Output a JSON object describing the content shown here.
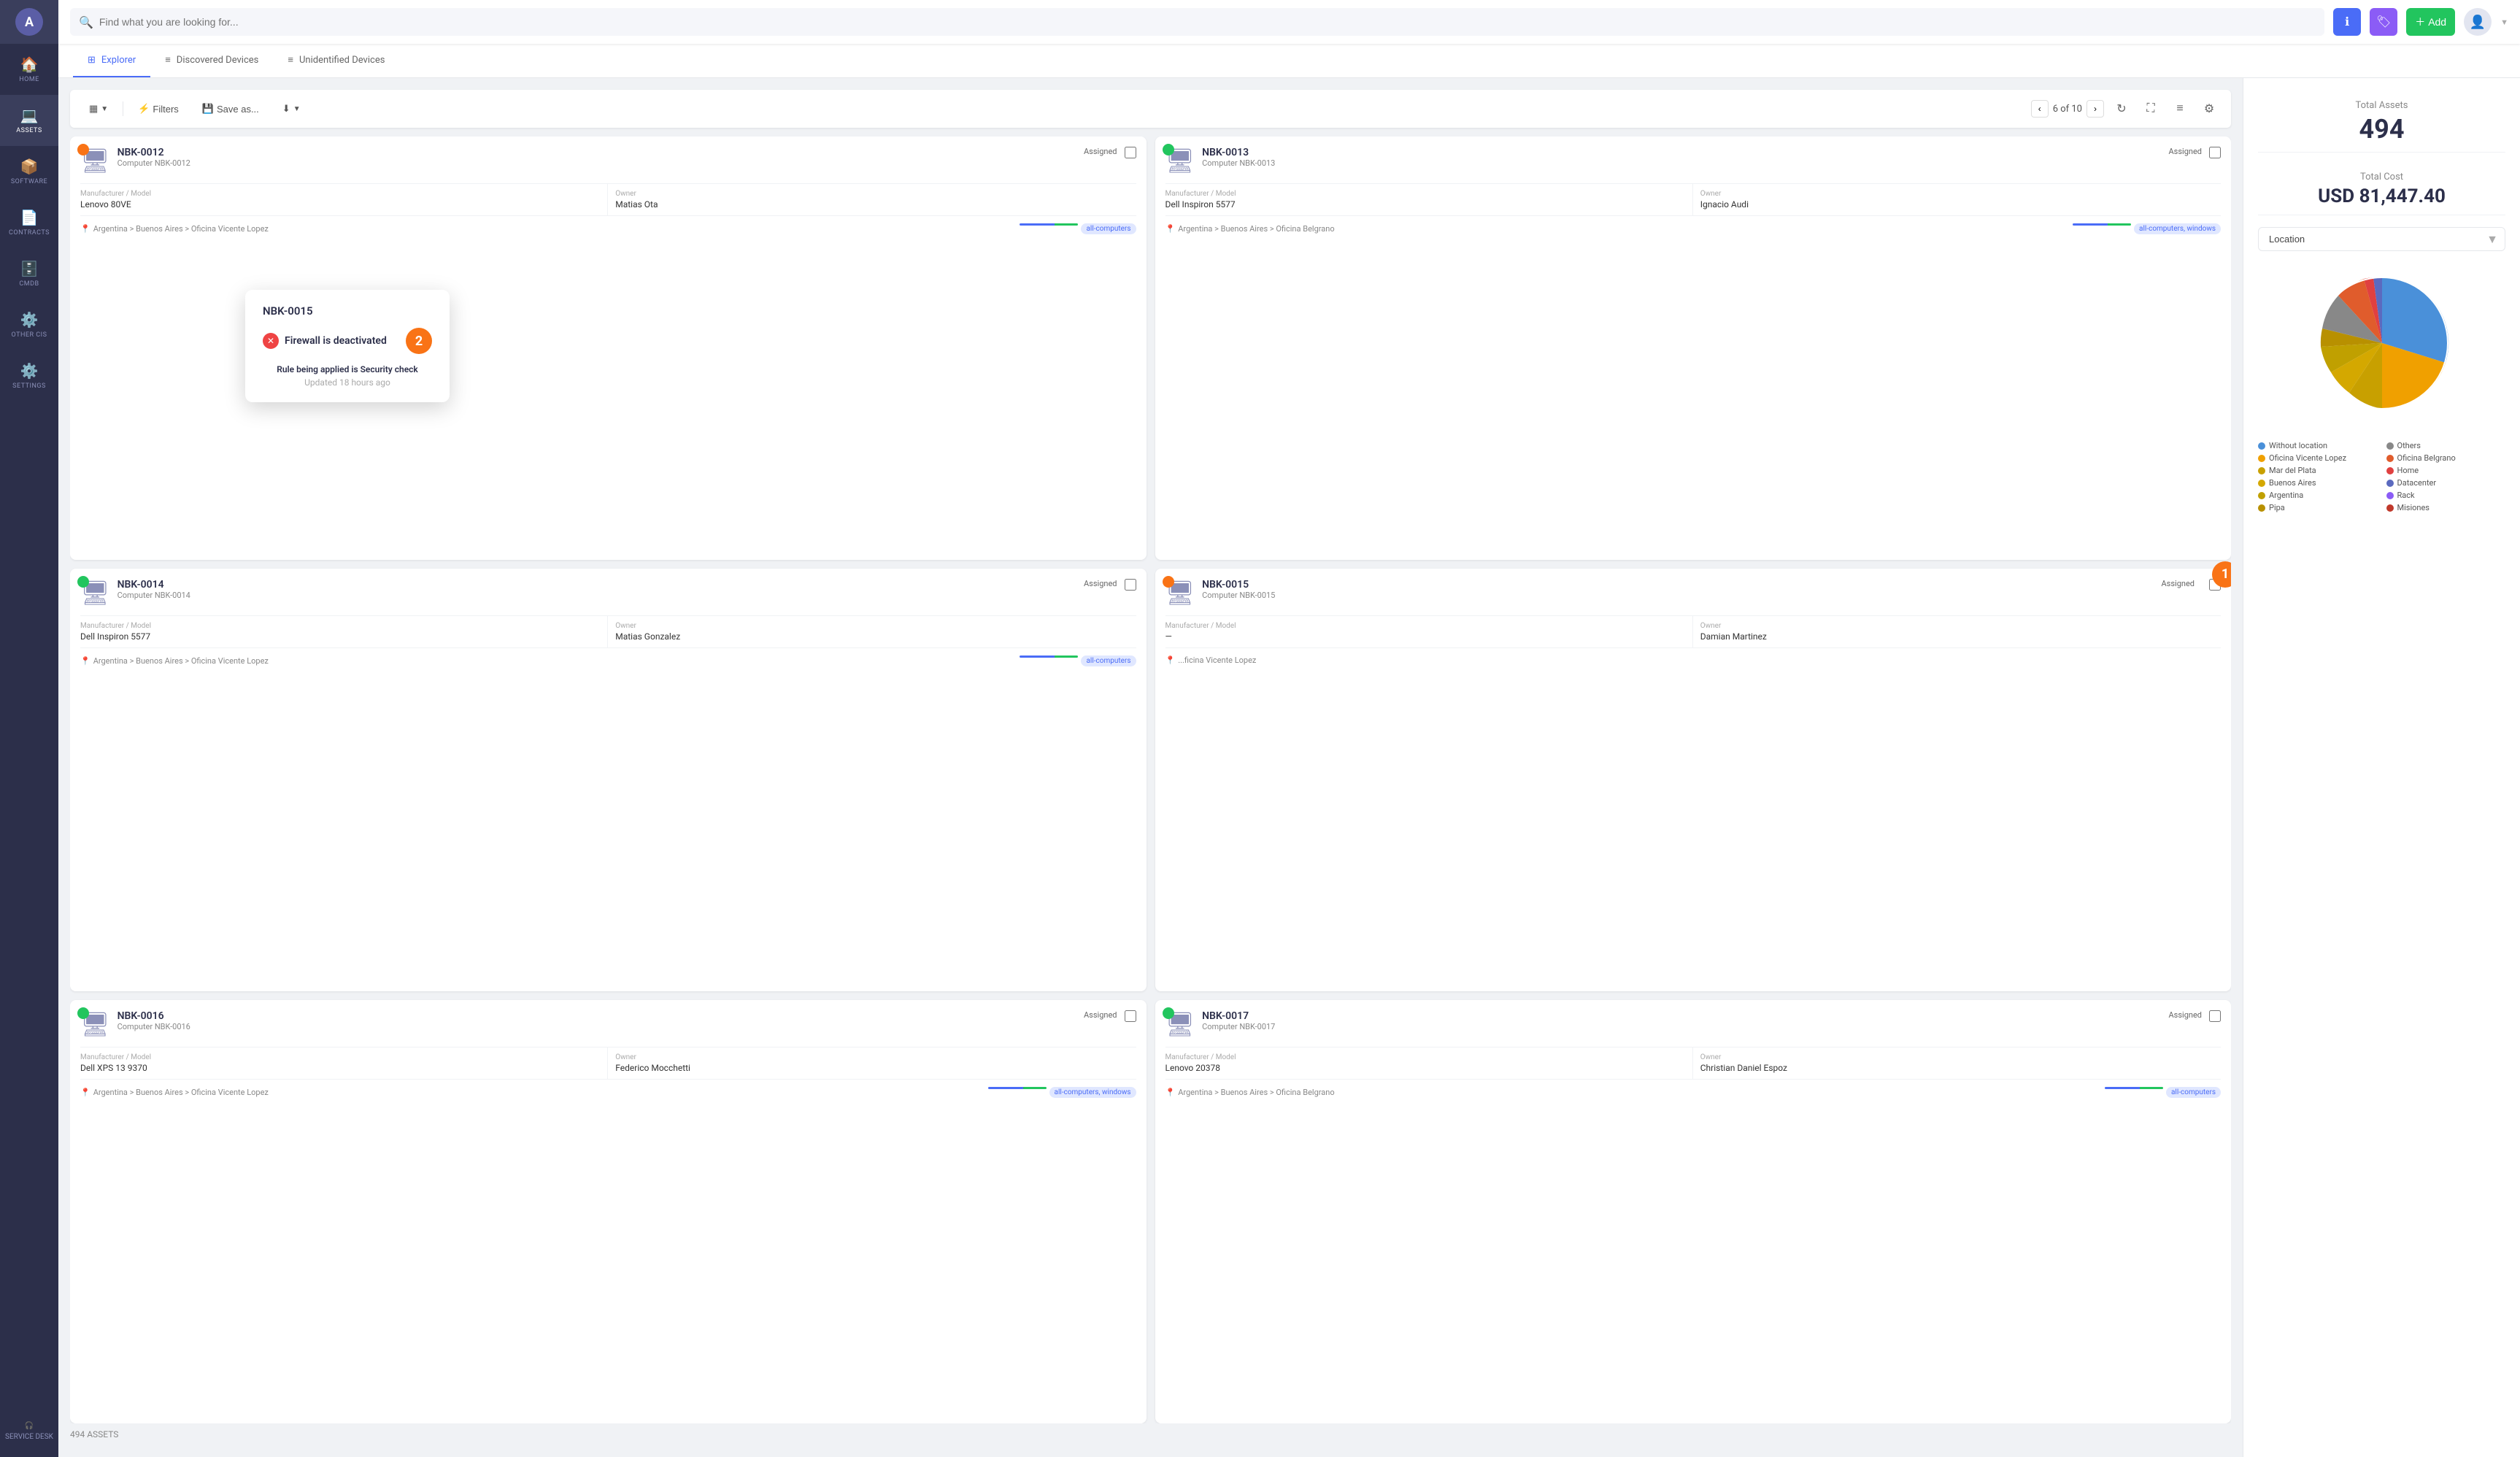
{
  "sidebar": {
    "logo": "A",
    "items": [
      {
        "id": "home",
        "label": "HOME",
        "icon": "🏠",
        "active": false
      },
      {
        "id": "assets",
        "label": "ASSETS",
        "icon": "💻",
        "active": true
      },
      {
        "id": "software",
        "label": "SOFTWARE",
        "icon": "📦",
        "active": false
      },
      {
        "id": "contracts",
        "label": "CONTRACTS",
        "icon": "📄",
        "active": false
      },
      {
        "id": "cmdb",
        "label": "CMDB",
        "icon": "🗄️",
        "active": false
      },
      {
        "id": "other",
        "label": "OTHER CIs",
        "icon": "⚙️",
        "active": false
      },
      {
        "id": "settings",
        "label": "SETTINGS",
        "icon": "⚙️",
        "active": false
      }
    ],
    "bottom": {
      "label": "SERVICE DESK",
      "icon": "🎧"
    }
  },
  "topbar": {
    "search_placeholder": "Find what you are looking for...",
    "btn_info": "ℹ",
    "btn_tag": "🏷",
    "btn_add": "+ Add",
    "avatar_icon": "👤"
  },
  "tabs": [
    {
      "id": "explorer",
      "label": "Explorer",
      "active": true,
      "icon": "⊞"
    },
    {
      "id": "discovered",
      "label": "Discovered Devices",
      "active": false,
      "icon": "≡"
    },
    {
      "id": "unidentified",
      "label": "Unidentified Devices",
      "active": false,
      "icon": "≡"
    }
  ],
  "toolbar": {
    "view_btn": "▦",
    "filters_label": "Filters",
    "save_label": "Save as...",
    "download_label": "↓",
    "pagination": {
      "current": "6",
      "total": "10",
      "label": "6 of 10"
    },
    "refresh_icon": "↻",
    "expand_icon": "⛶",
    "list_icon": "≡",
    "settings_icon": "⚙"
  },
  "cards": [
    {
      "id": "NBK-0012",
      "title": "NBK-0012",
      "subtitle": "Computer NBK-0012",
      "badge": "Assigned",
      "alert_type": "orange",
      "manufacturer_label": "Manufacturer / Model",
      "manufacturer": "Lenovo 80VE",
      "owner_label": "Owner",
      "owner": "Matias Ota",
      "location": "Argentina > Buenos Aires > Oficina Vicente Lopez",
      "tags": [
        "all-computers"
      ],
      "has_alert": true
    },
    {
      "id": "NBK-0013",
      "title": "NBK-0013",
      "subtitle": "Computer NBK-0013",
      "badge": "Assigned",
      "alert_type": "green",
      "manufacturer_label": "Manufacturer / Model",
      "manufacturer": "Dell Inspiron 5577",
      "owner_label": "Owner",
      "owner": "Ignacio Audi",
      "location": "Argentina > Buenos Aires > Oficina Belgrano",
      "tags": [
        "all-computers",
        "windows"
      ],
      "has_alert": true
    },
    {
      "id": "NBK-0014",
      "title": "NBK-0014",
      "subtitle": "Computer NBK-0014",
      "badge": "Assigned",
      "alert_type": "green",
      "manufacturer_label": "Manufacturer / Model",
      "manufacturer": "Dell Inspiron 5577",
      "owner_label": "Owner",
      "owner": "Matias Gonzalez",
      "location": "Argentina > Buenos Aires > Oficina Vicente Lopez",
      "tags": [
        "all-computers"
      ],
      "has_alert": true,
      "has_popup": false
    },
    {
      "id": "NBK-0015",
      "title": "NBK-0015",
      "subtitle": "Computer NBK-0015",
      "badge": "Assigned",
      "alert_type": "orange",
      "manufacturer_label": "Manufacturer / Model",
      "manufacturer": "—",
      "owner_label": "Owner",
      "owner": "Damian Martinez",
      "location": "...ficina Vicente Lopez",
      "tags": [],
      "has_alert": true,
      "has_popup": true
    },
    {
      "id": "NBK-0016",
      "title": "NBK-0016",
      "subtitle": "Computer NBK-0016",
      "badge": "Assigned",
      "alert_type": "green",
      "manufacturer_label": "Manufacturer / Model",
      "manufacturer": "Dell XPS 13 9370",
      "owner_label": "Owner",
      "owner": "Federico Mocchetti",
      "location": "Argentina > Buenos Aires > Oficina Vicente Lopez",
      "tags": [
        "all-computers",
        "windows"
      ],
      "has_alert": true
    },
    {
      "id": "NBK-0017",
      "title": "NBK-0017",
      "subtitle": "Computer NBK-0017",
      "badge": "Assigned",
      "alert_type": "green",
      "manufacturer_label": "Manufacturer / Model",
      "manufacturer": "Lenovo 20378",
      "owner_label": "Owner",
      "owner": "Christian Daniel Espoz",
      "location": "Argentina > Buenos Aires > Oficina Belgrano",
      "tags": [
        "all-computers"
      ],
      "has_alert": true
    }
  ],
  "popup": {
    "device_id": "NBK-0015",
    "alert_icon": "✕",
    "alert_text": "Firewall is deactivated",
    "badge_number": "2",
    "rule_prefix": "Rule being applied is",
    "rule_name": "Security check",
    "updated": "Updated 18 hours ago"
  },
  "right_panel": {
    "total_assets_label": "Total Assets",
    "total_assets_value": "494",
    "total_cost_label": "Total Cost",
    "total_cost_value": "USD 81,447.40",
    "location_label": "Location",
    "chart": {
      "segments": [
        {
          "label": "Without location",
          "color": "#4a90d9",
          "value": 35
        },
        {
          "label": "Oficina Vicente Lopez",
          "color": "#f0a000",
          "value": 20
        },
        {
          "label": "Mar del Plata",
          "color": "#c8a000",
          "value": 5
        },
        {
          "label": "Buenos Aires",
          "color": "#d4a800",
          "value": 3
        },
        {
          "label": "Argentina",
          "color": "#c0a000",
          "value": 2
        },
        {
          "label": "Pipa",
          "color": "#b89000",
          "value": 2
        },
        {
          "label": "Others",
          "color": "#888",
          "value": 4
        },
        {
          "label": "Oficina Belgrano",
          "color": "#e05c2c",
          "value": 8
        },
        {
          "label": "Home",
          "color": "#e04040",
          "value": 3
        },
        {
          "label": "Datacenter",
          "color": "#5b6abf",
          "value": 10
        },
        {
          "label": "Rack",
          "color": "#8b5cf6",
          "value": 5
        },
        {
          "label": "Misiones",
          "color": "#c0392b",
          "value": 3
        }
      ]
    },
    "legend": [
      {
        "label": "Without location",
        "color": "#4a90d9"
      },
      {
        "label": "Others",
        "color": "#888"
      },
      {
        "label": "Oficina Vicente Lopez",
        "color": "#f0a000"
      },
      {
        "label": "Oficina Belgrano",
        "color": "#e05c2c"
      },
      {
        "label": "Mar del Plata",
        "color": "#c8a000"
      },
      {
        "label": "Home",
        "color": "#e04040"
      },
      {
        "label": "Buenos Aires",
        "color": "#d4a800"
      },
      {
        "label": "Datacenter",
        "color": "#5b6abf"
      },
      {
        "label": "Argentina",
        "color": "#c0a000"
      },
      {
        "label": "Rack",
        "color": "#8b5cf6"
      },
      {
        "label": "Pipa",
        "color": "#b89000"
      },
      {
        "label": "Misiones",
        "color": "#c0392b"
      }
    ]
  },
  "footer": {
    "count_label": "494 ASSETS"
  }
}
